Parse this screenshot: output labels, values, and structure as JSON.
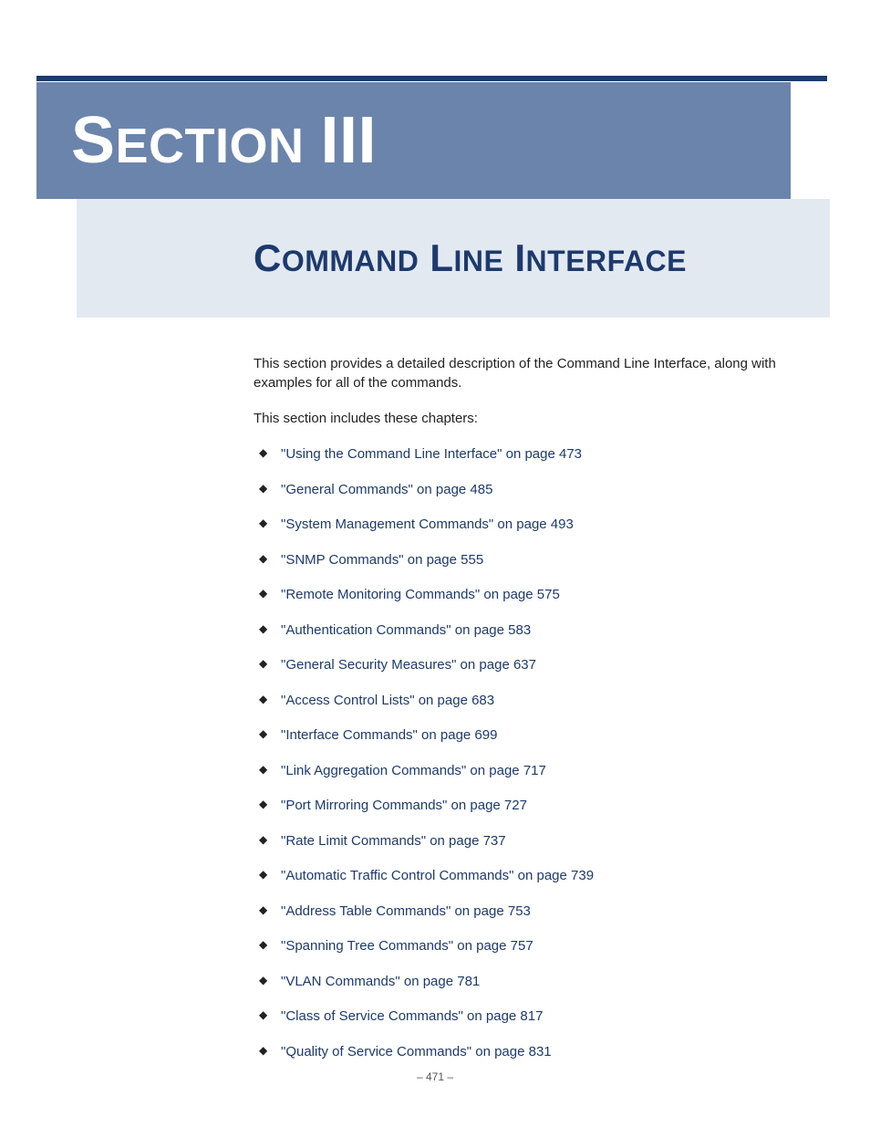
{
  "header": {
    "section_big_s": "S",
    "section_rest": "ECTION",
    "section_big_i": "III"
  },
  "subtitle": {
    "c1": "C",
    "r1": "OMMAND",
    "c2": "L",
    "r2": "INE",
    "c3": "I",
    "r3": "NTERFACE"
  },
  "intro": "This section provides a detailed description of the Command Line Interface, along with examples for all of the commands.",
  "lead": "This section includes these chapters:",
  "chapters": [
    {
      "label": "\"Using the Command Line Interface\" on page 473"
    },
    {
      "label": "\"General Commands\" on page 485"
    },
    {
      "label": "\"System Management Commands\" on page 493"
    },
    {
      "label": "\"SNMP Commands\" on page 555"
    },
    {
      "label": "\"Remote Monitoring Commands\" on page 575"
    },
    {
      "label": "\"Authentication Commands\" on page 583"
    },
    {
      "label": "\"General Security Measures\" on page 637"
    },
    {
      "label": "\"Access Control Lists\" on page 683"
    },
    {
      "label": "\"Interface Commands\" on page 699"
    },
    {
      "label": "\"Link Aggregation Commands\" on page 717"
    },
    {
      "label": "\"Port Mirroring Commands\" on page 727"
    },
    {
      "label": "\"Rate Limit Commands\" on page 737"
    },
    {
      "label": "\"Automatic Traffic Control Commands\" on page 739"
    },
    {
      "label": "\"Address Table Commands\" on page 753"
    },
    {
      "label": "\"Spanning Tree Commands\" on page 757"
    },
    {
      "label": "\"VLAN Commands\" on page 781"
    },
    {
      "label": "\"Class of Service Commands\" on page 817"
    },
    {
      "label": "\"Quality of Service Commands\" on page 831"
    }
  ],
  "page_number": "–  471  –"
}
